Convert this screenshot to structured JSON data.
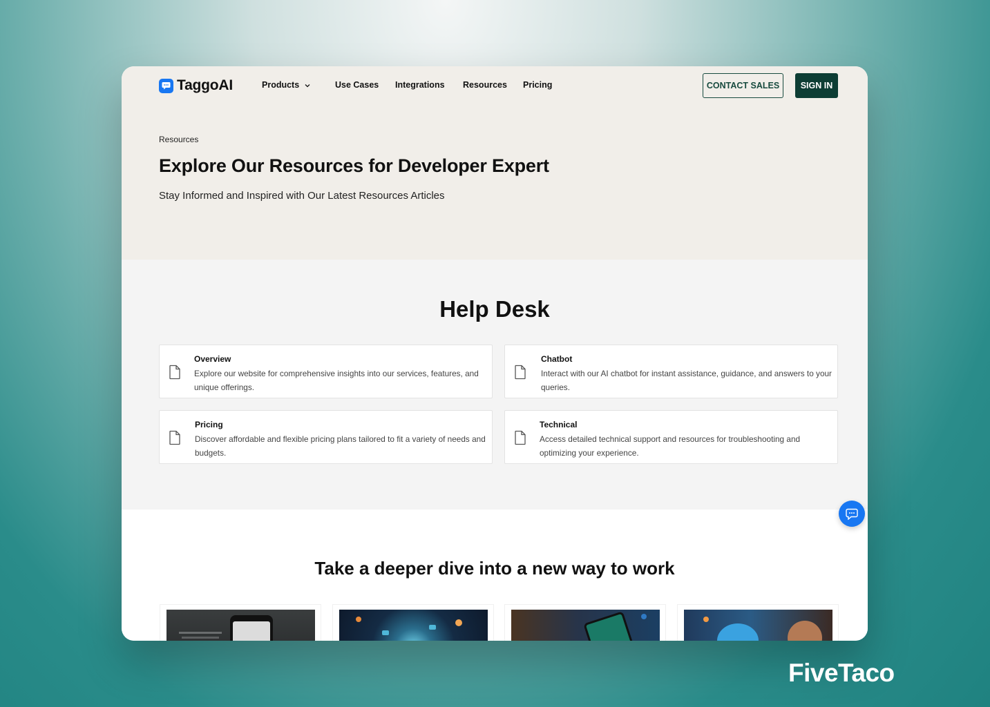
{
  "brand_overlay": "FiveTaco",
  "nav": {
    "logo_text": "TaggoAI",
    "items": [
      {
        "label": "Products",
        "has_dropdown": true
      },
      {
        "label": "Use Cases"
      },
      {
        "label": "Integrations"
      },
      {
        "label": "Resources"
      },
      {
        "label": "Pricing"
      }
    ],
    "contact_sales": "CONTACT SALES",
    "sign_in": "SIGN IN"
  },
  "hero": {
    "breadcrumb": "Resources",
    "title": "Explore Our Resources for Developer Expert",
    "subtitle": "Stay Informed and Inspired with Our Latest Resources Articles"
  },
  "help_desk": {
    "title": "Help Desk",
    "cards": [
      {
        "title": "Overview",
        "description": "Explore our website for comprehensive insights into our services, features, and unique offerings.",
        "icon": "document-icon"
      },
      {
        "title": "Chatbot",
        "description": "Interact with our AI chatbot for instant assistance, guidance, and answers to your queries.",
        "icon": "document-icon"
      },
      {
        "title": "Pricing",
        "description": "Discover affordable and flexible pricing plans tailored to fit a variety of needs and budgets.",
        "icon": "document-icon"
      },
      {
        "title": "Technical",
        "description": "Access detailed technical support and resources for troubleshooting and optimizing your experience.",
        "icon": "document-icon"
      }
    ]
  },
  "dive": {
    "title": "Take a deeper dive into a new way to work"
  },
  "chat_widget": {
    "icon": "chat-bubble-icon"
  },
  "colors": {
    "accent_blue": "#1877f2",
    "dark_green": "#0d3d34",
    "hero_bg": "#f1eee9",
    "help_bg": "#f4f4f4"
  }
}
